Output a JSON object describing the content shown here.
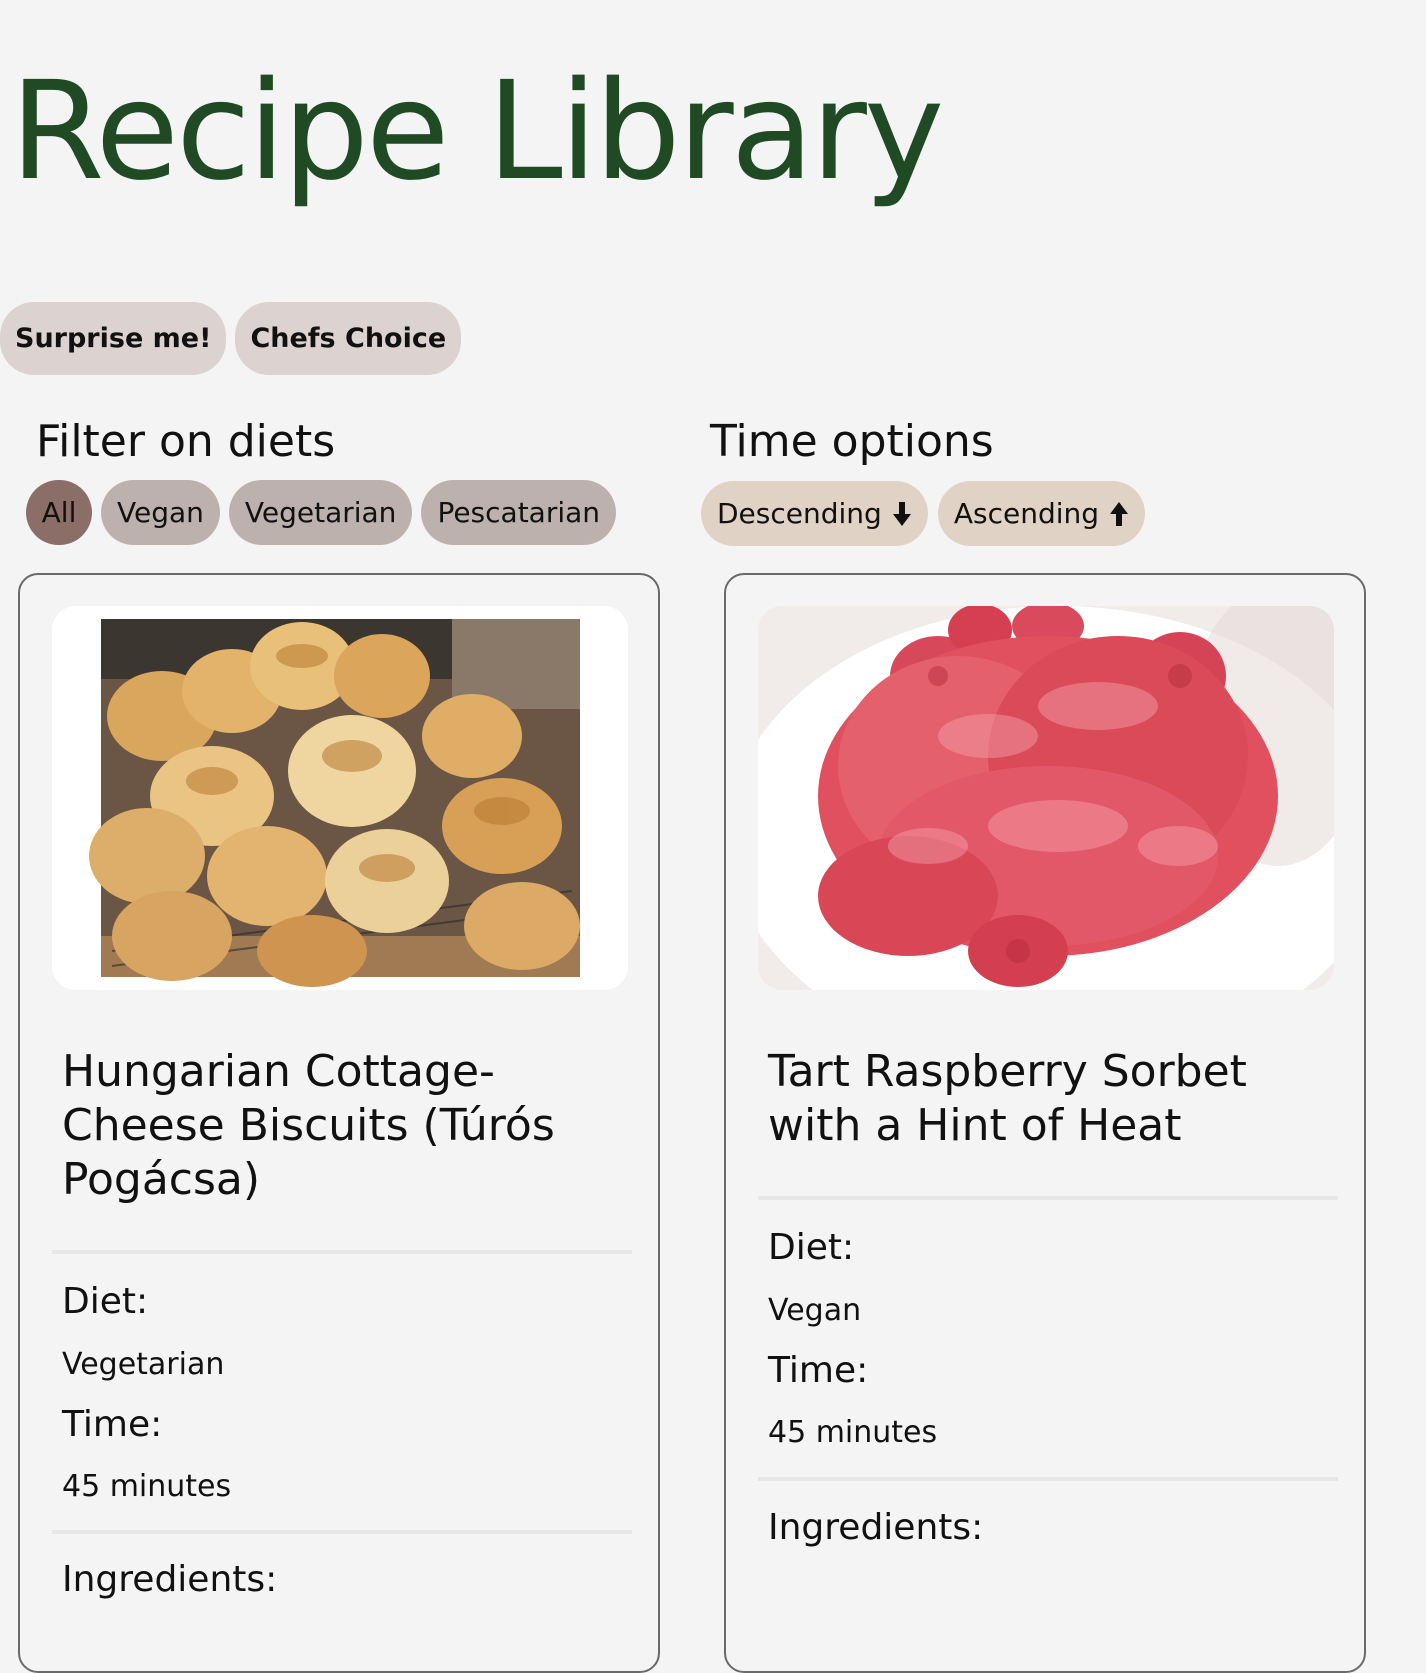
{
  "header": {
    "title": "Recipe Library"
  },
  "actions": {
    "surprise_label": "Surprise me!",
    "chefs_choice_label": "Chefs Choice"
  },
  "diet_filter": {
    "heading": "Filter on diets",
    "options": [
      "All",
      "Vegan",
      "Vegetarian",
      "Pescatarian"
    ],
    "selected": "All"
  },
  "time_options": {
    "heading": "Time options",
    "descending_label": "Descending",
    "descending_icon": "arrow-down-icon",
    "ascending_label": "Ascending",
    "ascending_icon": "arrow-up-icon"
  },
  "recipes": [
    {
      "title": "Hungarian Cottage-Cheese Biscuits (Túrós Pogácsa)",
      "diet_label": "Diet:",
      "diet": "Vegetarian",
      "time_label": "Time:",
      "time": "45 minutes",
      "ingredients_label": "Ingredients:",
      "image_subject": "biscuits"
    },
    {
      "title": "Tart Raspberry Sorbet with a Hint of Heat",
      "diet_label": "Diet:",
      "diet": "Vegan",
      "time_label": "Time:",
      "time": "45 minutes",
      "ingredients_label": "Ingredients:",
      "image_subject": "raspberry sorbet"
    }
  ],
  "colors": {
    "title": "#1f4a24",
    "action_button": "#dcd3d1",
    "diet_button": "#bdb1ae",
    "diet_button_active": "#8a6e67",
    "time_button": "#e1d2c6",
    "background": "#f4f4f4"
  }
}
